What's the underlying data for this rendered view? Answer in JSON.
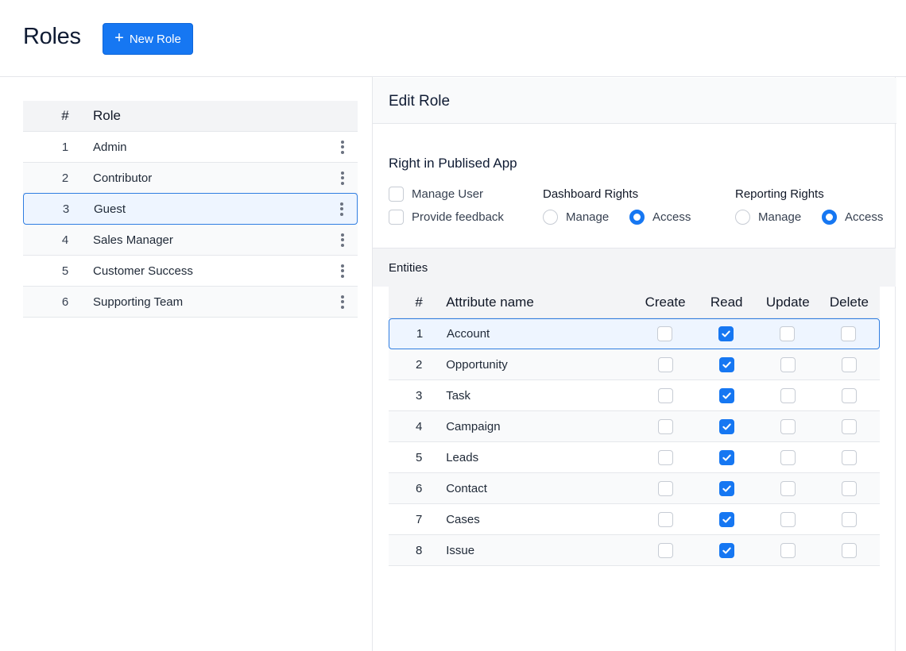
{
  "header": {
    "title": "Roles",
    "new_button": "New Role"
  },
  "roles": {
    "columns": {
      "num": "#",
      "role": "Role"
    },
    "rows": [
      {
        "num": "1",
        "name": "Admin"
      },
      {
        "num": "2",
        "name": "Contributor"
      },
      {
        "num": "3",
        "name": "Guest",
        "selected": true
      },
      {
        "num": "4",
        "name": "Sales Manager"
      },
      {
        "num": "5",
        "name": "Customer Success"
      },
      {
        "num": "6",
        "name": "Supporting Team"
      }
    ]
  },
  "edit": {
    "title": "Edit Role",
    "rights_title": "Right in Publised App",
    "app_rights": [
      "Manage User",
      "Provide feedback"
    ],
    "dashboard": {
      "label": "Dashboard Rights",
      "options": [
        "Manage",
        "Access"
      ],
      "selected": "Access"
    },
    "reporting": {
      "label": "Reporting Rights",
      "options": [
        "Manage",
        "Access"
      ],
      "selected": "Access"
    }
  },
  "entities": {
    "title": "Entities",
    "columns": {
      "num": "#",
      "name": "Attribute name",
      "create": "Create",
      "read": "Read",
      "update": "Update",
      "delete": "Delete"
    },
    "rows": [
      {
        "num": "1",
        "name": "Account",
        "create": false,
        "read": true,
        "update": false,
        "delete": false
      },
      {
        "num": "2",
        "name": "Opportunity",
        "create": false,
        "read": true,
        "update": false,
        "delete": false
      },
      {
        "num": "3",
        "name": "Task",
        "create": false,
        "read": true,
        "update": false,
        "delete": false
      },
      {
        "num": "4",
        "name": "Campaign",
        "create": false,
        "read": true,
        "update": false,
        "delete": false
      },
      {
        "num": "5",
        "name": "Leads",
        "create": false,
        "read": true,
        "update": false,
        "delete": false
      },
      {
        "num": "6",
        "name": "Contact",
        "create": false,
        "read": true,
        "update": false,
        "delete": false
      },
      {
        "num": "7",
        "name": "Cases",
        "create": false,
        "read": true,
        "update": false,
        "delete": false
      },
      {
        "num": "8",
        "name": "Issue",
        "create": false,
        "read": true,
        "update": false,
        "delete": false
      }
    ]
  },
  "colors": {
    "accent": "#1677f2",
    "selected_bg": "#eef5ff",
    "selected_border": "#2f7de1"
  }
}
